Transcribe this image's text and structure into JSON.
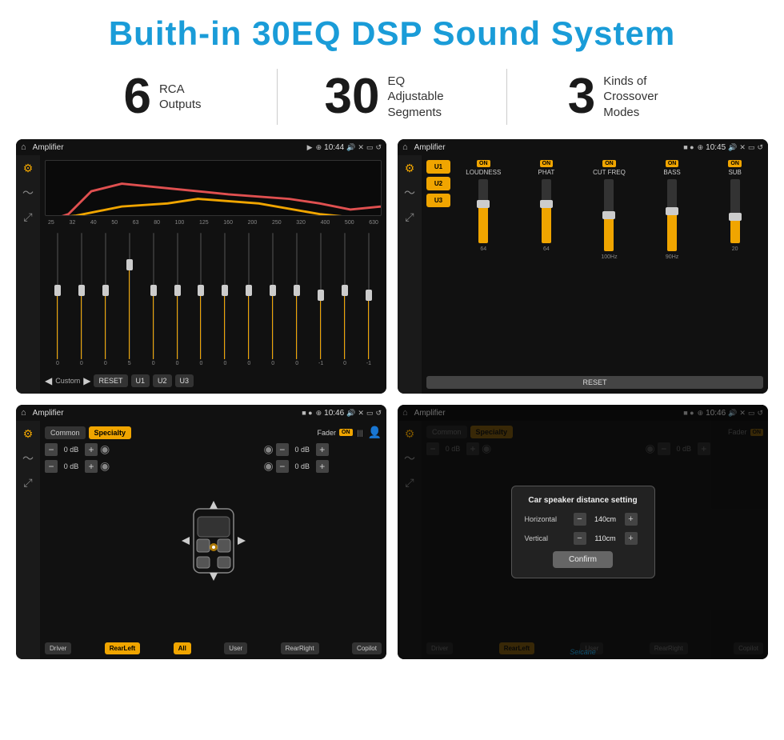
{
  "header": {
    "title": "Buith-in 30EQ DSP Sound System"
  },
  "stats": [
    {
      "number": "6",
      "label": "RCA\nOutputs"
    },
    {
      "number": "30",
      "label": "EQ Adjustable\nSegments"
    },
    {
      "number": "3",
      "label": "Kinds of\nCrossover Modes"
    }
  ],
  "screens": {
    "eq": {
      "title": "Amplifier",
      "time": "10:44",
      "freq_labels": [
        "25",
        "32",
        "40",
        "50",
        "63",
        "80",
        "100",
        "125",
        "160",
        "200",
        "250",
        "320",
        "400",
        "500",
        "630"
      ],
      "slider_values": [
        "0",
        "0",
        "0",
        "5",
        "0",
        "0",
        "0",
        "0",
        "0",
        "0",
        "0",
        "-1",
        "0",
        "-1"
      ],
      "preset_label": "Custom",
      "buttons": [
        "RESET",
        "U1",
        "U2",
        "U3"
      ]
    },
    "amp": {
      "title": "Amplifier",
      "time": "10:45",
      "presets": [
        "U1",
        "U2",
        "U3"
      ],
      "channels": [
        {
          "label": "LOUDNESS",
          "on": true
        },
        {
          "label": "PHAT",
          "on": true
        },
        {
          "label": "CUT FREQ",
          "on": true
        },
        {
          "label": "BASS",
          "on": true
        },
        {
          "label": "SUB",
          "on": true
        }
      ],
      "reset_label": "RESET"
    },
    "fader": {
      "title": "Amplifier",
      "time": "10:46",
      "tabs": [
        "Common",
        "Specialty"
      ],
      "fader_label": "Fader",
      "on": "ON",
      "controls": {
        "top_left": "0 dB",
        "mid_left": "0 dB",
        "top_right": "0 dB",
        "mid_right": "0 dB"
      },
      "footer_btns": [
        "Driver",
        "RearLeft",
        "All",
        "User",
        "RearRight",
        "Copilot"
      ]
    },
    "dialog": {
      "title": "Amplifier",
      "time": "10:46",
      "dialog_title": "Car speaker distance setting",
      "horizontal_label": "Horizontal",
      "horizontal_value": "140cm",
      "vertical_label": "Vertical",
      "vertical_value": "110cm",
      "confirm_label": "Confirm",
      "footer_btns": [
        "Driver",
        "RearLeft",
        "User",
        "RearRight",
        "Copilot"
      ]
    }
  },
  "watermark": "Seicane"
}
